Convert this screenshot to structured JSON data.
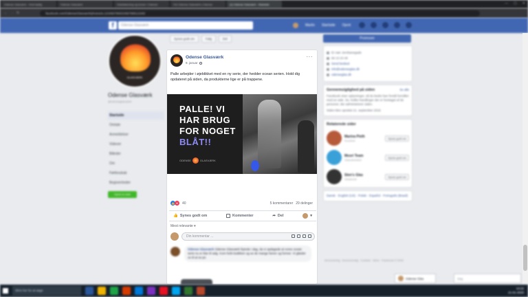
{
  "browser": {
    "tabs": [
      "Odense Glasværk - Hvid Nyttig",
      "Odense Glasværk",
      "Glasblæsning og kurser i Odense",
      "Om Odense Glasværk | Odense",
      "(1) Odense Glasværk - Startside"
    ],
    "url": "facebook.com/OdenseGlasvaerk/photos/a.1234567890/2456789012345/"
  },
  "fb": {
    "logo": "f",
    "search_placeholder": "Odense Glasværk",
    "nav": [
      "Martin",
      "Startside",
      "Opret"
    ]
  },
  "page": {
    "name": "Odense Glasværk",
    "handle": "@odenseglasvaerk",
    "profile_text": "GLASVÆRK",
    "nav": [
      "Startside",
      "Omtale",
      "Anmeldelser",
      "Videoer",
      "Billeder",
      "Om",
      "Fællesskab",
      "Begivenheder"
    ],
    "create_page": "Opret en side"
  },
  "toolbar": {
    "liked": "Synes godt om",
    "follow": "Følg",
    "share": "Del"
  },
  "post": {
    "author": "Odense Glasværk",
    "date": "9. januar",
    "text": "Palle arbejder i øjeblikket med en ny serie, der hedder ocean serien. Hold dig opdateret på siden, da produkterne lige er på trappene.",
    "image_headline_1": "PALLE! VI",
    "image_headline_2": "HAR BRUG",
    "image_headline_3": "FOR NOGET",
    "image_headline_accent": "BLÅT!!",
    "image_brand_left": "ODENSE",
    "image_brand_right": "GLASVÆRK",
    "reaction_count": "40",
    "comments_count": "5 kommentarer",
    "shares_count": "29 delinger",
    "like_label": "Synes godt om",
    "comment_label": "Kommenter",
    "share_label": "Del",
    "sort_label": "Mest relevante",
    "comment_placeholder": "Din kommentar ...",
    "comment_author": "Odense Glasværk",
    "comment_text": "Odense Glasværk fejrede i dag, da vi opdagede at vores ocean serie nu er klar til salg. Kom forbi butikken og se de mange farver og former. Vi glæder os til at se jer."
  },
  "right": {
    "promote": "Promover",
    "info": [
      "Er nær Jernbanegade",
      "66 13 23 49",
      "Send besked",
      "info@odenseglas.dk",
      "odenseglas.dk"
    ],
    "transparency_title": "Gennemsigtighed på siden",
    "transparency_link": "Se alle",
    "transparency_text": "Facebook viser oplysninger, så du bedre kan forstå formålet med en side. Se, hvilke handlinger der er foretaget af de personer, der administrerer siden.",
    "created": "Siden blev oprettet 21. september 2015",
    "related_title": "Relaterede sider",
    "related": [
      {
        "name": "Marina Pieth",
        "sub": "Kunstner",
        "btn": "Synes godt om"
      },
      {
        "name": "Mosri Team",
        "sub": "Glasværksted",
        "btn": "Synes godt om"
      },
      {
        "name": "Sten's Glas",
        "sub": "Glaskunst",
        "btn": "Synes godt om"
      }
    ],
    "langs": "Dansk · English (US) · Polski · Español · Português (Brasil)",
    "footer": "Annoncering · Annoncevalg · Cookies · Mere · Facebook © 2020"
  },
  "chat": {
    "name": "Odense Glas",
    "search": "Søg"
  },
  "taskbar": {
    "search": "Skriv her for at søge",
    "time": "14:22",
    "date": "21-01-2020"
  },
  "colors": {
    "fb_blue": "#4267b2",
    "link": "#385898",
    "accent_blue_text": "#8f8cf5"
  }
}
